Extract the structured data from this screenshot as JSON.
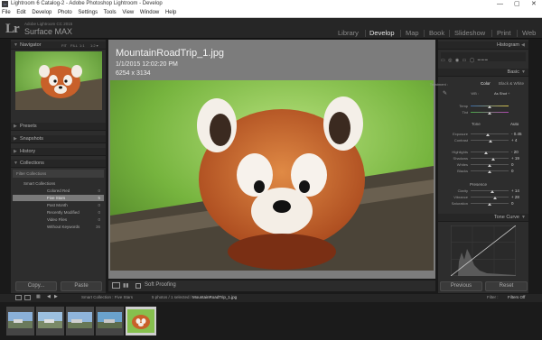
{
  "window": {
    "title": "Lightroom 6 Catalog-2 - Adobe Photoshop Lightroom - Develop",
    "controls": [
      "—",
      "▢",
      "✕"
    ]
  },
  "menu": [
    "File",
    "Edit",
    "Develop",
    "Photo",
    "Settings",
    "Tools",
    "View",
    "Window",
    "Help"
  ],
  "identity": {
    "logo": "Lr",
    "catalog": "Adobe Lightroom CC 2015",
    "name": "Surface MAX"
  },
  "modules": [
    "Library",
    "Develop",
    "Map",
    "Book",
    "Slideshow",
    "Print",
    "Web"
  ],
  "left": {
    "navigator": "Navigator",
    "nav_zoom": [
      "FIT",
      "FILL",
      "1:1",
      "1:2 ▾"
    ],
    "panels": [
      "Presets",
      "Snapshots",
      "History",
      "Collections"
    ],
    "filter_collections": "Filter Collections",
    "smart_collections": "Smart Collections",
    "collections": [
      {
        "name": "Colored Red",
        "count": "0"
      },
      {
        "name": "Five Stars",
        "count": "5"
      },
      {
        "name": "Past Month",
        "count": "0"
      },
      {
        "name": "Recently Modified",
        "count": "0"
      },
      {
        "name": "Video Files",
        "count": "0"
      },
      {
        "name": "Without Keywords",
        "count": "36"
      }
    ],
    "copy": "Copy...",
    "paste": "Paste"
  },
  "photo": {
    "filename": "MountainRoadTrip_1.jpg",
    "date": "1/1/2015 12:02:20 PM",
    "dims": "6254 x 3134"
  },
  "toolbar": {
    "soft_proofing": "Soft Proofing"
  },
  "right": {
    "histogram": "Histogram",
    "basic": "Basic",
    "treatment": "Treatment :",
    "color": "Color",
    "bw": "Black & White",
    "wb": "WB :",
    "wb_value": "As Shot ÷",
    "temp": "Temp",
    "tint": "Tint",
    "tone": "Tone",
    "auto": "Auto",
    "tone_sliders": [
      {
        "label": "Exposure",
        "value": "- 0.45",
        "pos": 0.45
      },
      {
        "label": "Contrast",
        "value": "+ 4",
        "pos": 0.52
      }
    ],
    "hl_sliders": [
      {
        "label": "Highlights",
        "value": "- 20",
        "pos": 0.4
      },
      {
        "label": "Shadows",
        "value": "+ 19",
        "pos": 0.6
      },
      {
        "label": "Whites",
        "value": "0",
        "pos": 0.5
      },
      {
        "label": "Blacks",
        "value": "0",
        "pos": 0.5
      }
    ],
    "presence": "Presence",
    "presence_sliders": [
      {
        "label": "Clarity",
        "value": "+ 14",
        "pos": 0.57
      },
      {
        "label": "Vibrance",
        "value": "+ 28",
        "pos": 0.64
      },
      {
        "label": "Saturation",
        "value": "0",
        "pos": 0.5
      }
    ],
    "tone_curve": "Tone Curve",
    "previous": "Previous",
    "reset": "Reset"
  },
  "filmstrip": {
    "pages": [
      "1",
      "2"
    ],
    "source": "Smart Collection : Five Stars",
    "info": "5 photos / 1 selected /",
    "selected": "MountainRoadTrip_1.jpg",
    "filter_label": "Filter :",
    "filter_value": "Filters Off"
  }
}
